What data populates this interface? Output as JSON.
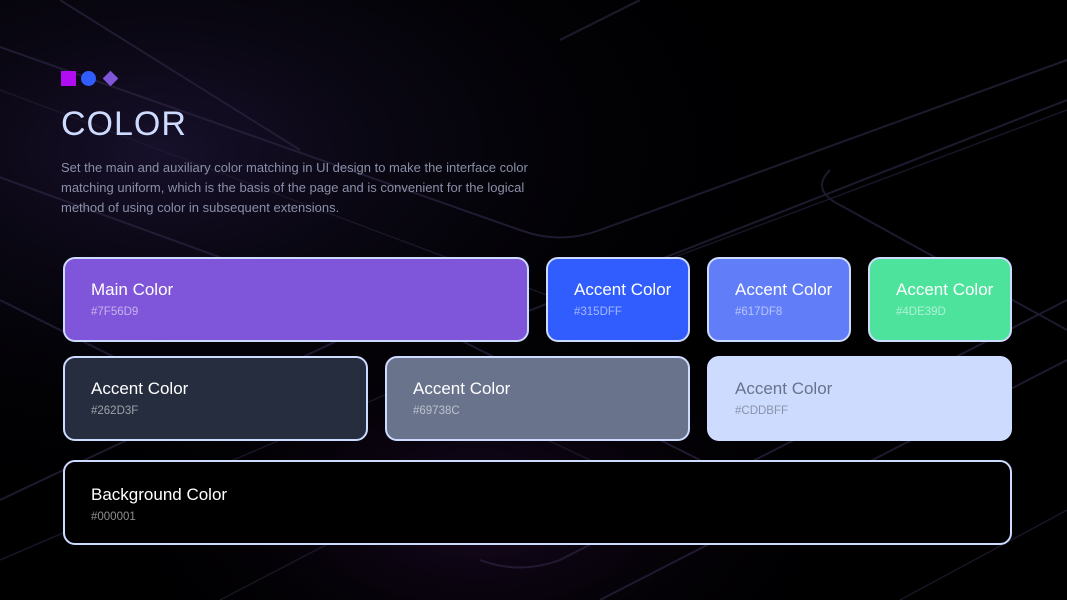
{
  "header": {
    "title": "COLOR",
    "description": "Set the main and auxiliary color matching in UI design to make the interface color matching uniform, which is the basis of the page and is convenient for the logical method of using color in subsequent extensions.",
    "logo_icons": [
      "square-icon",
      "circle-icon",
      "diamond-icon"
    ]
  },
  "swatches": [
    {
      "label": "Main Color",
      "hex": "#7F56D9",
      "color": "#7F56D9"
    },
    {
      "label": "Accent Color",
      "hex": "#315DFF",
      "color": "#315DFF"
    },
    {
      "label": "Accent Color",
      "hex": "#617DF8",
      "color": "#617DF8"
    },
    {
      "label": "Accent Color",
      "hex": "#4DE39D",
      "color": "#4DE39D"
    },
    {
      "label": "Accent Color",
      "hex": "#262D3F",
      "color": "#262D3F"
    },
    {
      "label": "Accent Color",
      "hex": "#69738C",
      "color": "#69738C"
    },
    {
      "label": "Accent Color",
      "hex": "#CDDBFF",
      "color": "#CDDBFF"
    },
    {
      "label": "Background Color",
      "hex": "#000001",
      "color": "#000001"
    }
  ],
  "colors": {
    "background": "#000001",
    "title": "#CDDBFF",
    "border": "#CDDBFF",
    "logo_square": "#B10CF2",
    "logo_circle": "#315DFF",
    "logo_diamond": "#7F56D9"
  }
}
